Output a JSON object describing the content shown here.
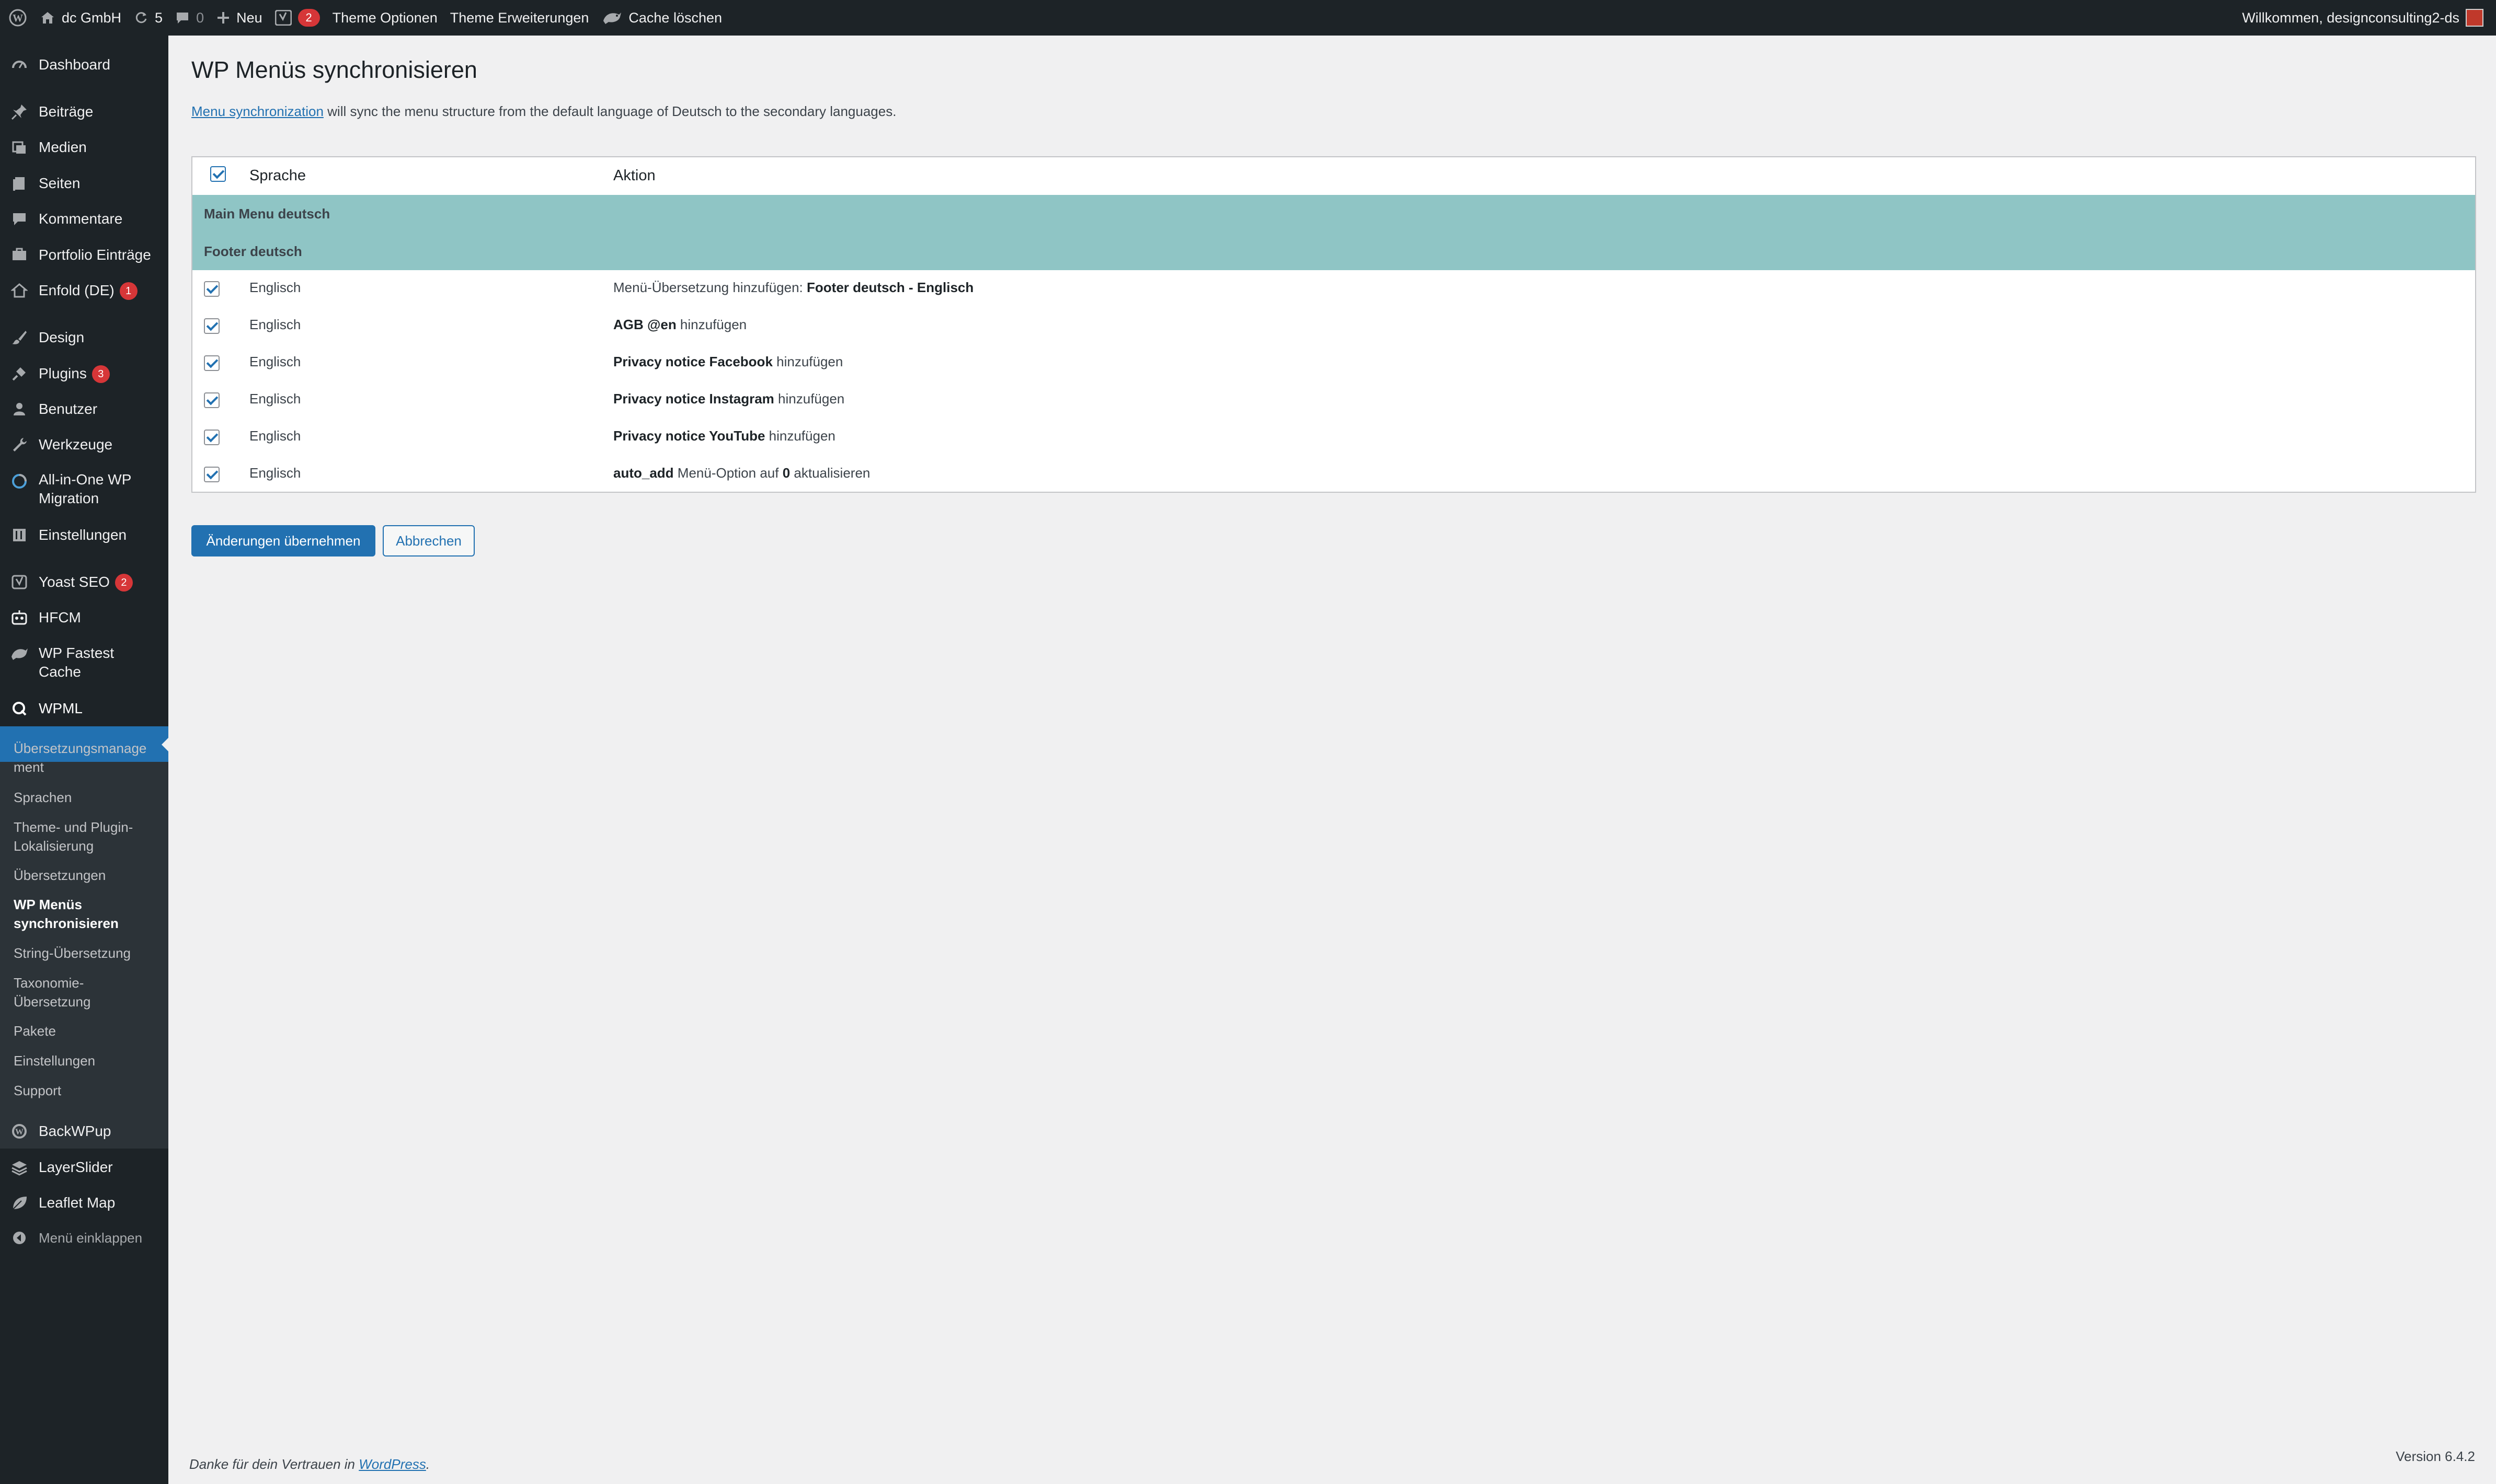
{
  "adminbar": {
    "site_name": "dc GmbH",
    "updates_count": "5",
    "comments_count": "0",
    "new_label": "Neu",
    "yoast_badge": "2",
    "theme_options": "Theme Optionen",
    "theme_extensions": "Theme Erweiterungen",
    "cache_clear": "Cache löschen",
    "welcome": "Willkommen, designconsulting2-ds"
  },
  "sidebar": {
    "items": [
      {
        "label": "Dashboard",
        "icon": "dashboard-icon"
      },
      {
        "label": "Beiträge",
        "icon": "pin-icon"
      },
      {
        "label": "Medien",
        "icon": "media-icon"
      },
      {
        "label": "Seiten",
        "icon": "pages-icon"
      },
      {
        "label": "Kommentare",
        "icon": "comment-icon"
      },
      {
        "label": "Portfolio Einträge",
        "icon": "portfolio-icon"
      },
      {
        "label": "Enfold (DE)",
        "icon": "home-icon",
        "badge": "1"
      },
      {
        "label": "Design",
        "icon": "brush-icon"
      },
      {
        "label": "Plugins",
        "icon": "plugin-icon",
        "badge": "3"
      },
      {
        "label": "Benutzer",
        "icon": "user-icon"
      },
      {
        "label": "Werkzeuge",
        "icon": "wrench-icon"
      },
      {
        "label": "All-in-One WP",
        "label2": "Migration",
        "icon": "migration-icon"
      },
      {
        "label": "Einstellungen",
        "icon": "settings-icon"
      },
      {
        "label": "Yoast SEO",
        "icon": "yoast-icon",
        "badge": "2"
      },
      {
        "label": "HFCM",
        "icon": "robot-icon"
      },
      {
        "label": "WP Fastest",
        "label2": "Cache",
        "icon": "cheetah-icon"
      },
      {
        "label": "WPML",
        "icon": "wpml-icon"
      },
      {
        "label": "BackWPup",
        "icon": "backwpup-icon"
      },
      {
        "label": "LayerSlider",
        "icon": "layers-icon"
      },
      {
        "label": "Leaflet Map",
        "icon": "leaf-icon"
      },
      {
        "label": "Menü einklappen",
        "icon": "collapse-icon"
      }
    ],
    "submenu": [
      {
        "label": "Übersetzungsmanage",
        "label2": "ment"
      },
      {
        "label": "Sprachen"
      },
      {
        "label": "Theme- und Plugin-",
        "label2": "Lokalisierung"
      },
      {
        "label": "Übersetzungen"
      },
      {
        "label": "WP Menüs",
        "label2": "synchronisieren"
      },
      {
        "label": "String-Übersetzung"
      },
      {
        "label": "Taxonomie-",
        "label2": "Übersetzung"
      },
      {
        "label": "Pakete"
      },
      {
        "label": "Einstellungen"
      },
      {
        "label": "Support"
      }
    ]
  },
  "page": {
    "title": "WP Menüs synchronisieren",
    "intro_link": "Menu synchronization",
    "intro_text": " will sync the menu structure from the default language of Deutsch to the secondary languages."
  },
  "table": {
    "col_language": "Sprache",
    "col_action": "Aktion",
    "menu_groups": [
      "Main Menu deutsch",
      "Footer deutsch"
    ],
    "rows": [
      {
        "lang": "Englisch",
        "pre": "Menü-Übersetzung hinzufügen: ",
        "bold": "Footer deutsch - Englisch",
        "post": ""
      },
      {
        "lang": "Englisch",
        "pre": "",
        "bold": "AGB @en",
        "post": " hinzufügen"
      },
      {
        "lang": "Englisch",
        "pre": "",
        "bold": "Privacy notice Facebook",
        "post": " hinzufügen"
      },
      {
        "lang": "Englisch",
        "pre": "",
        "bold": "Privacy notice Instagram",
        "post": " hinzufügen"
      },
      {
        "lang": "Englisch",
        "pre": "",
        "bold": "Privacy notice YouTube",
        "post": " hinzufügen"
      },
      {
        "lang": "Englisch",
        "pre": "",
        "bold": "auto_add",
        "post": " Menü-Option auf ",
        "bold2": "0",
        "post2": " aktualisieren"
      }
    ]
  },
  "buttons": {
    "apply": "Änderungen übernehmen",
    "cancel": "Abbrechen"
  },
  "footer": {
    "thanks_text": "Danke für dein Vertrauen in ",
    "thanks_link": "WordPress",
    "thanks_end": ".",
    "version": "Version 6.4.2"
  },
  "colors": {
    "admin_dark": "#1d2327",
    "accent": "#2271b1",
    "menu_group_bg": "#8fc5c5",
    "badge": "#d63638"
  }
}
